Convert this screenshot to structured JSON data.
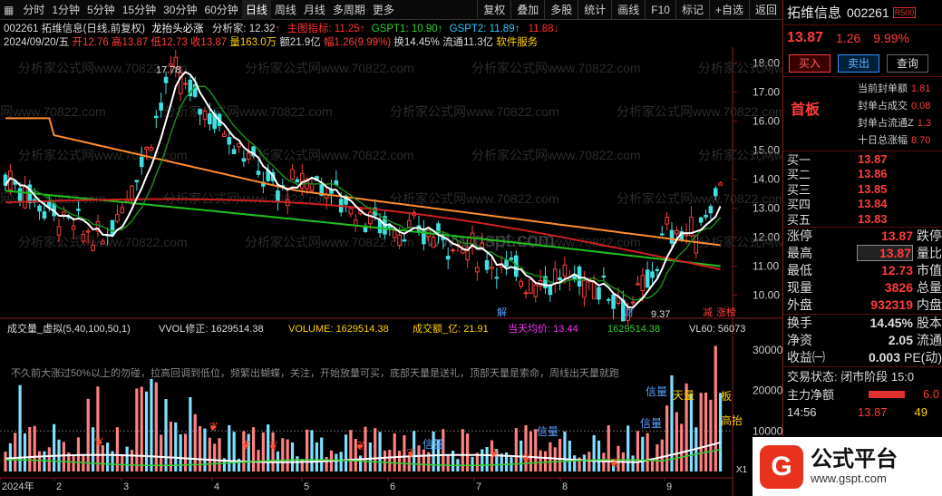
{
  "toolbar": {
    "periods": [
      "分时",
      "1分钟",
      "5分钟",
      "15分钟",
      "30分钟",
      "60分钟",
      "日线",
      "周线",
      "月线",
      "多周期",
      "更多"
    ],
    "active": "日线",
    "right": [
      "复权",
      "叠加",
      "多股",
      "统计",
      "画线",
      "F10",
      "标记",
      "+自选",
      "返回"
    ]
  },
  "info1": {
    "code_name": "002261 拓维信息(日线,前复权)",
    "indicator": "龙抬头必涨",
    "analyst": "分析家: 12.32",
    "main": "主图指标: 11.25",
    "gspt1": "GSPT1: 10.90",
    "gspt2": "GSPT2: 11.89",
    "extra": "11.88"
  },
  "info2": {
    "date": "2024/09/20/五",
    "open": "开12.76",
    "high": "高13.87",
    "low": "低12.73",
    "close": "收13.87",
    "vol": "量163.0万",
    "amt": "额21.9亿",
    "chg": "幅1.26(9.99%)",
    "turn": "换14.45%",
    "float": "流通11.3亿",
    "sector": "软件服务"
  },
  "price_axis": [
    "18.00",
    "17.00",
    "16.00",
    "15.00",
    "14.00",
    "13.00",
    "12.00",
    "11.00",
    "10.00"
  ],
  "price_marks": {
    "high": "17.78",
    "low": "9.37"
  },
  "watermark": "分析家公式网www.70822.com",
  "watermark2": "www.gspt.com",
  "vol_header": {
    "name": "成交量_虚拟(5,40,100,50,1)",
    "vvol": "VVOL修正: 1629514.38",
    "volume": "VOLUME: 1629514.38",
    "amount": "成交额_亿: 21.91",
    "avgp": "当天均价: 13.44",
    "v2": "1629514.38",
    "vl60": "VL60: 56073"
  },
  "vol_note": "不久前大涨过50%以上的勿碰，拉高回调到低位，频繁出蝴蝶，关注，开始放量可买，底部天量是送礼，顶部天量是索命，周线出天量就跑",
  "vol_axis": [
    "30000",
    "20000",
    "10000"
  ],
  "vol_tags": [
    "天量",
    "信量",
    "信量",
    "信量",
    "信量",
    "板",
    "高抬"
  ],
  "x_axis": [
    "2024年",
    "2",
    "3",
    "4",
    "5",
    "6",
    "7",
    "8",
    "9"
  ],
  "chart_marks": {
    "jie": "解",
    "cai": "财",
    "jian": "减",
    "zt": "涨榜",
    "x1": "X1"
  },
  "side": {
    "name": "拓维信息",
    "code": "002261",
    "tag": "R500",
    "price": "13.87",
    "chg": "1.26",
    "pct": "9.99%",
    "buy": "买入",
    "sell": "卖出",
    "query": "查询",
    "board": "首板",
    "feng": [
      {
        "label": "当前封单额",
        "val": "1.81"
      },
      {
        "label": "封单占成交",
        "val": "0.08"
      },
      {
        "label": "封单占流通Z",
        "val": "1.3"
      },
      {
        "label": "十日总涨幅",
        "val": "8.70"
      }
    ],
    "orderbook": [
      {
        "label": "买一",
        "val": "13.87"
      },
      {
        "label": "买二",
        "val": "13.86"
      },
      {
        "label": "买三",
        "val": "13.85"
      },
      {
        "label": "买四",
        "val": "13.84"
      },
      {
        "label": "买五",
        "val": "13.83"
      }
    ],
    "stats": [
      {
        "l": "涨停",
        "v": "13.87",
        "l2": "跌停"
      },
      {
        "l": "最高",
        "v": "13.87",
        "l2": "量比"
      },
      {
        "l": "最低",
        "v": "12.73",
        "l2": "市值"
      },
      {
        "l": "现量",
        "v": "3826",
        "l2": "总量"
      },
      {
        "l": "外盘",
        "v": "932319",
        "l2": "内盘"
      }
    ],
    "stats2": [
      {
        "l": "换手",
        "v": "14.45%",
        "l2": "股本"
      },
      {
        "l": "净资",
        "v": "2.05",
        "l2": "流通"
      },
      {
        "l": "收益㈠",
        "v": "0.003",
        "l2": "PE(动)"
      }
    ],
    "trade_state": "交易状态: 闭市阶段 15:0",
    "zhuli": "主力净额",
    "zhuli_v": "6.0",
    "time": "14:56",
    "time_p": "13.87",
    "time_v": "49"
  },
  "logo": {
    "t1": "公式平台",
    "t2": "www.gspt.com"
  }
}
